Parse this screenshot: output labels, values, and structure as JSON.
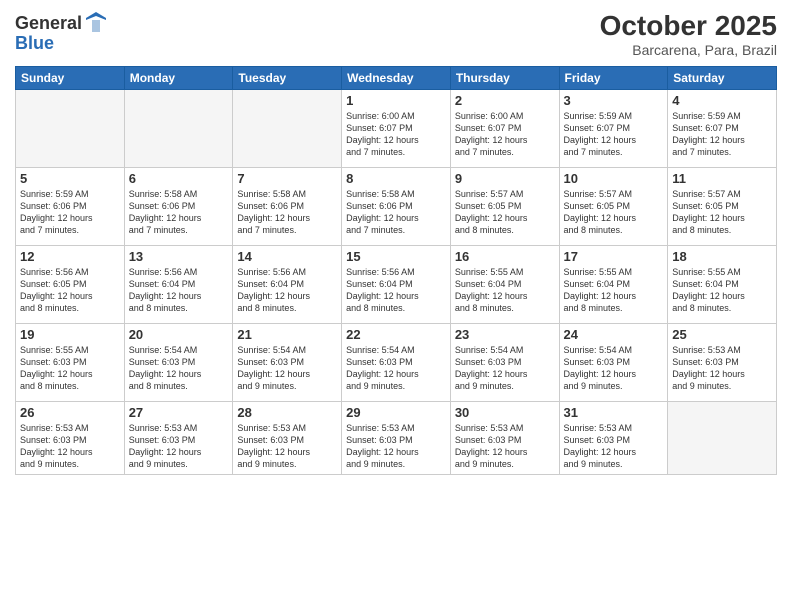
{
  "logo": {
    "general": "General",
    "blue": "Blue"
  },
  "header": {
    "month": "October 2025",
    "location": "Barcarena, Para, Brazil"
  },
  "weekdays": [
    "Sunday",
    "Monday",
    "Tuesday",
    "Wednesday",
    "Thursday",
    "Friday",
    "Saturday"
  ],
  "weeks": [
    [
      {
        "day": "",
        "text": ""
      },
      {
        "day": "",
        "text": ""
      },
      {
        "day": "",
        "text": ""
      },
      {
        "day": "1",
        "text": "Sunrise: 6:00 AM\nSunset: 6:07 PM\nDaylight: 12 hours\nand 7 minutes."
      },
      {
        "day": "2",
        "text": "Sunrise: 6:00 AM\nSunset: 6:07 PM\nDaylight: 12 hours\nand 7 minutes."
      },
      {
        "day": "3",
        "text": "Sunrise: 5:59 AM\nSunset: 6:07 PM\nDaylight: 12 hours\nand 7 minutes."
      },
      {
        "day": "4",
        "text": "Sunrise: 5:59 AM\nSunset: 6:07 PM\nDaylight: 12 hours\nand 7 minutes."
      }
    ],
    [
      {
        "day": "5",
        "text": "Sunrise: 5:59 AM\nSunset: 6:06 PM\nDaylight: 12 hours\nand 7 minutes."
      },
      {
        "day": "6",
        "text": "Sunrise: 5:58 AM\nSunset: 6:06 PM\nDaylight: 12 hours\nand 7 minutes."
      },
      {
        "day": "7",
        "text": "Sunrise: 5:58 AM\nSunset: 6:06 PM\nDaylight: 12 hours\nand 7 minutes."
      },
      {
        "day": "8",
        "text": "Sunrise: 5:58 AM\nSunset: 6:06 PM\nDaylight: 12 hours\nand 7 minutes."
      },
      {
        "day": "9",
        "text": "Sunrise: 5:57 AM\nSunset: 6:05 PM\nDaylight: 12 hours\nand 8 minutes."
      },
      {
        "day": "10",
        "text": "Sunrise: 5:57 AM\nSunset: 6:05 PM\nDaylight: 12 hours\nand 8 minutes."
      },
      {
        "day": "11",
        "text": "Sunrise: 5:57 AM\nSunset: 6:05 PM\nDaylight: 12 hours\nand 8 minutes."
      }
    ],
    [
      {
        "day": "12",
        "text": "Sunrise: 5:56 AM\nSunset: 6:05 PM\nDaylight: 12 hours\nand 8 minutes."
      },
      {
        "day": "13",
        "text": "Sunrise: 5:56 AM\nSunset: 6:04 PM\nDaylight: 12 hours\nand 8 minutes."
      },
      {
        "day": "14",
        "text": "Sunrise: 5:56 AM\nSunset: 6:04 PM\nDaylight: 12 hours\nand 8 minutes."
      },
      {
        "day": "15",
        "text": "Sunrise: 5:56 AM\nSunset: 6:04 PM\nDaylight: 12 hours\nand 8 minutes."
      },
      {
        "day": "16",
        "text": "Sunrise: 5:55 AM\nSunset: 6:04 PM\nDaylight: 12 hours\nand 8 minutes."
      },
      {
        "day": "17",
        "text": "Sunrise: 5:55 AM\nSunset: 6:04 PM\nDaylight: 12 hours\nand 8 minutes."
      },
      {
        "day": "18",
        "text": "Sunrise: 5:55 AM\nSunset: 6:04 PM\nDaylight: 12 hours\nand 8 minutes."
      }
    ],
    [
      {
        "day": "19",
        "text": "Sunrise: 5:55 AM\nSunset: 6:03 PM\nDaylight: 12 hours\nand 8 minutes."
      },
      {
        "day": "20",
        "text": "Sunrise: 5:54 AM\nSunset: 6:03 PM\nDaylight: 12 hours\nand 8 minutes."
      },
      {
        "day": "21",
        "text": "Sunrise: 5:54 AM\nSunset: 6:03 PM\nDaylight: 12 hours\nand 9 minutes."
      },
      {
        "day": "22",
        "text": "Sunrise: 5:54 AM\nSunset: 6:03 PM\nDaylight: 12 hours\nand 9 minutes."
      },
      {
        "day": "23",
        "text": "Sunrise: 5:54 AM\nSunset: 6:03 PM\nDaylight: 12 hours\nand 9 minutes."
      },
      {
        "day": "24",
        "text": "Sunrise: 5:54 AM\nSunset: 6:03 PM\nDaylight: 12 hours\nand 9 minutes."
      },
      {
        "day": "25",
        "text": "Sunrise: 5:53 AM\nSunset: 6:03 PM\nDaylight: 12 hours\nand 9 minutes."
      }
    ],
    [
      {
        "day": "26",
        "text": "Sunrise: 5:53 AM\nSunset: 6:03 PM\nDaylight: 12 hours\nand 9 minutes."
      },
      {
        "day": "27",
        "text": "Sunrise: 5:53 AM\nSunset: 6:03 PM\nDaylight: 12 hours\nand 9 minutes."
      },
      {
        "day": "28",
        "text": "Sunrise: 5:53 AM\nSunset: 6:03 PM\nDaylight: 12 hours\nand 9 minutes."
      },
      {
        "day": "29",
        "text": "Sunrise: 5:53 AM\nSunset: 6:03 PM\nDaylight: 12 hours\nand 9 minutes."
      },
      {
        "day": "30",
        "text": "Sunrise: 5:53 AM\nSunset: 6:03 PM\nDaylight: 12 hours\nand 9 minutes."
      },
      {
        "day": "31",
        "text": "Sunrise: 5:53 AM\nSunset: 6:03 PM\nDaylight: 12 hours\nand 9 minutes."
      },
      {
        "day": "",
        "text": ""
      }
    ]
  ]
}
